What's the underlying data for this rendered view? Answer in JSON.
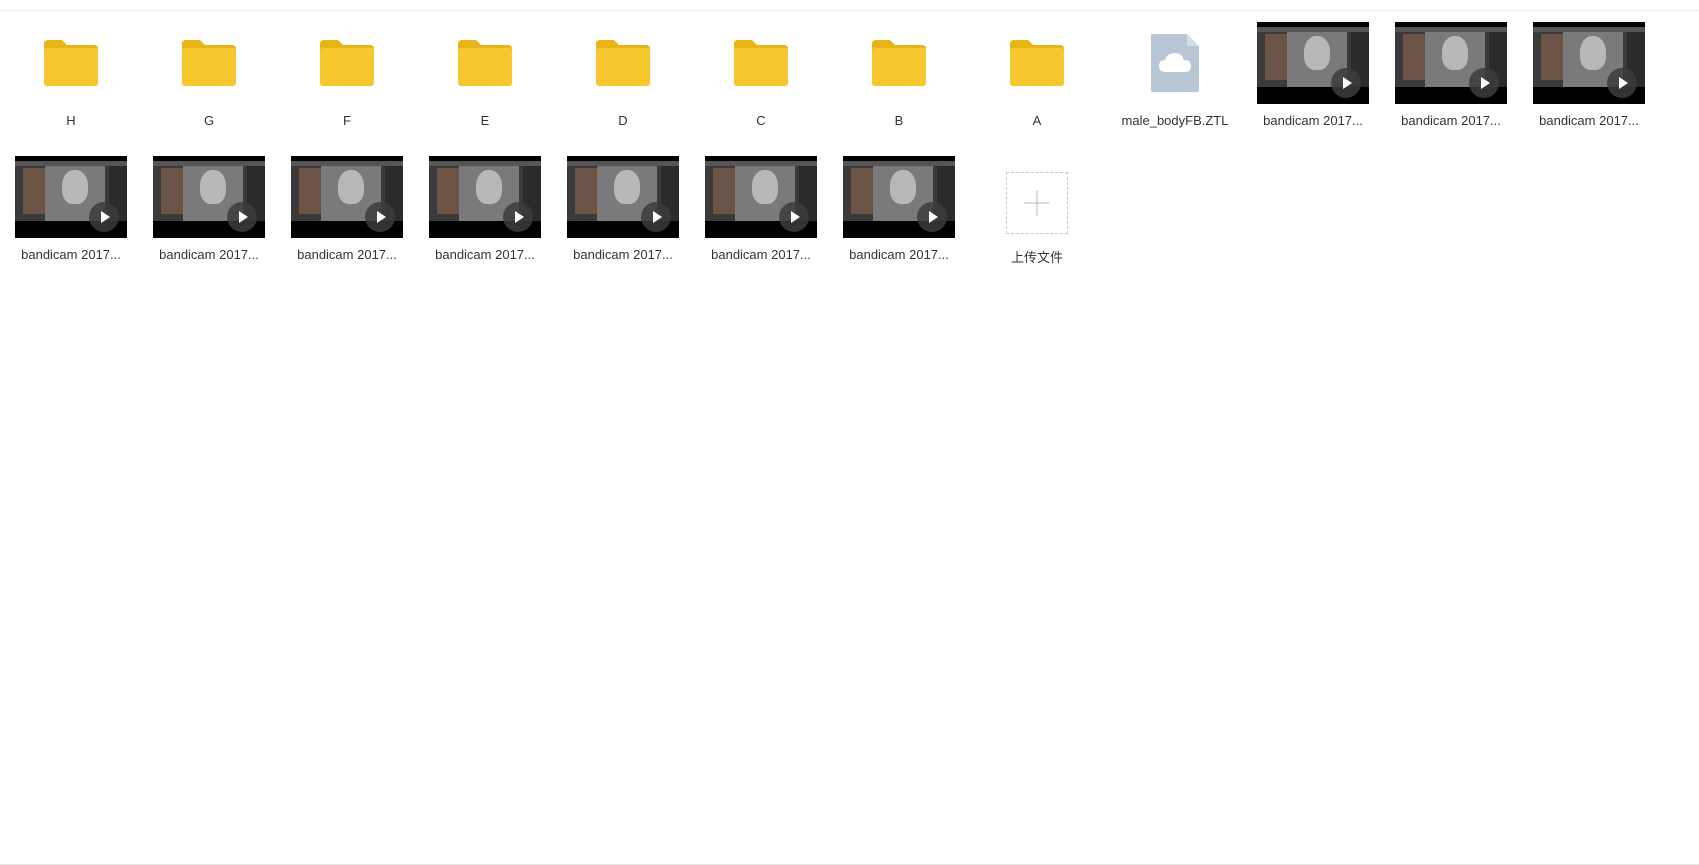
{
  "colors": {
    "folder": "#F7C82D",
    "folder_tab": "#E9B416",
    "file_icon": "#B8C6D6",
    "label_text": "#333333"
  },
  "items": [
    {
      "type": "folder",
      "label": "H",
      "icon": "folder-icon"
    },
    {
      "type": "folder",
      "label": "G",
      "icon": "folder-icon"
    },
    {
      "type": "folder",
      "label": "F",
      "icon": "folder-icon"
    },
    {
      "type": "folder",
      "label": "E",
      "icon": "folder-icon"
    },
    {
      "type": "folder",
      "label": "D",
      "icon": "folder-icon"
    },
    {
      "type": "folder",
      "label": "C",
      "icon": "folder-icon"
    },
    {
      "type": "folder",
      "label": "B",
      "icon": "folder-icon"
    },
    {
      "type": "folder",
      "label": "A",
      "icon": "folder-icon"
    },
    {
      "type": "file",
      "label": "male_bodyFB.ZTL",
      "icon": "cloud-file-icon"
    },
    {
      "type": "video",
      "label": "bandicam 2017...",
      "icon": "play-icon"
    },
    {
      "type": "video",
      "label": "bandicam 2017...",
      "icon": "play-icon"
    },
    {
      "type": "video",
      "label": "bandicam 2017...",
      "icon": "play-icon"
    },
    {
      "type": "video",
      "label": "bandicam 2017...",
      "icon": "play-icon"
    },
    {
      "type": "video",
      "label": "bandicam 2017...",
      "icon": "play-icon"
    },
    {
      "type": "video",
      "label": "bandicam 2017...",
      "icon": "play-icon"
    },
    {
      "type": "video",
      "label": "bandicam 2017...",
      "icon": "play-icon"
    },
    {
      "type": "video",
      "label": "bandicam 2017...",
      "icon": "play-icon"
    },
    {
      "type": "video",
      "label": "bandicam 2017...",
      "icon": "play-icon"
    },
    {
      "type": "video",
      "label": "bandicam 2017...",
      "icon": "play-icon"
    },
    {
      "type": "upload",
      "label": "上传文件",
      "icon": "plus-icon"
    }
  ]
}
